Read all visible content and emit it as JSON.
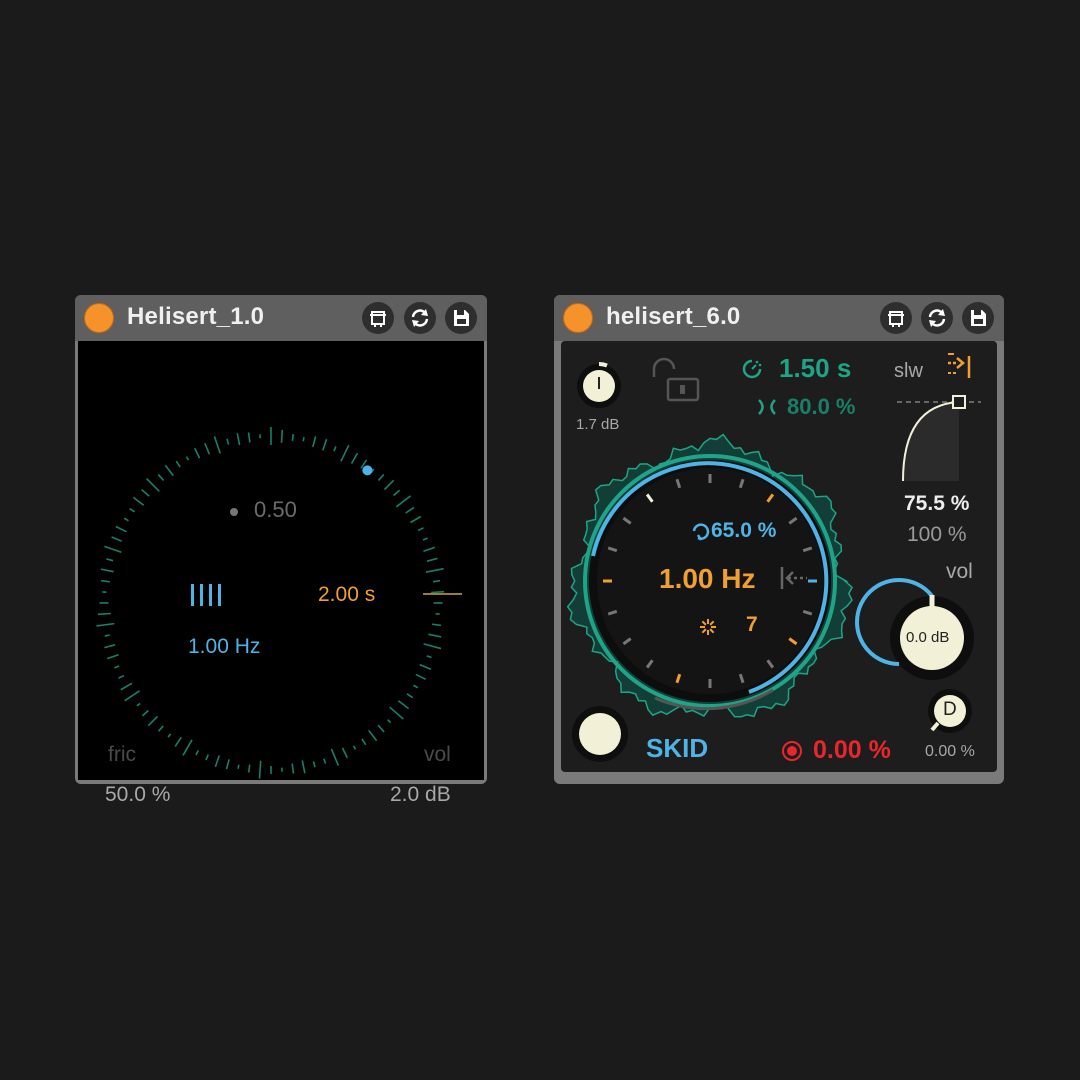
{
  "device1": {
    "title": "Helisert_1.0",
    "inner_value": "0.50",
    "time_value": "2.00 s",
    "rate_value": "1.00 Hz",
    "fric_label": "fric",
    "fric_value": "50.0 %",
    "vol_label": "vol",
    "vol_value": "2.0 dB"
  },
  "device2": {
    "title": "helisert_6.0",
    "gain_value": "1.7 dB",
    "time_value": "1.50 s",
    "feedback_value": "80.0 %",
    "slw_label": "slw",
    "curve_value": "75.5 %",
    "curve_max": "100 %",
    "vol_label": "vol",
    "vol_value": "0.0 dB",
    "inner_percent": "65.0 %",
    "rate_value": "1.00 Hz",
    "steps_value": "7",
    "skid_label": "SKID",
    "rec_value": "0.00 %",
    "d_label": "D",
    "d_value": "0.00 %",
    "gain_knob_label": "I"
  },
  "colors": {
    "orange": "#f59229",
    "blue": "#4fb3e6",
    "teal": "#1fa487",
    "red": "#e8262e",
    "cream": "#f2f1d8"
  },
  "icons": [
    "device-view-icon",
    "refresh-icon",
    "save-icon",
    "lock-open-icon",
    "timer-icon",
    "feedback-icon",
    "to-end-icon",
    "loop-icon",
    "sparkle-icon",
    "reverse-icon",
    "record-icon"
  ]
}
